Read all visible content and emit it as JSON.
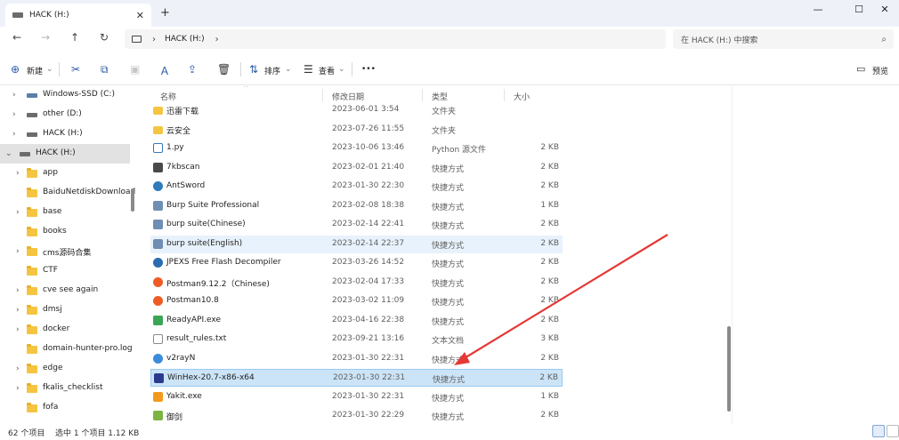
{
  "window": {
    "tab_title": "HACK (H:)",
    "tab_close": "✕",
    "new_tab": "+",
    "minimize": "—",
    "maximize": "☐",
    "close": "✕"
  },
  "nav": {
    "back": "←",
    "forward": "→",
    "up": "↑",
    "refresh": "↻",
    "chevron": "›",
    "path": "HACK (H:)",
    "path_chevron": "›",
    "search_placeholder": "在 HACK (H:) 中搜索",
    "search_icon": "⌕"
  },
  "toolbar": {
    "new_label": "新建",
    "new_dropdown": "⌄",
    "cut_icon": "✂",
    "copy_icon": "⧉",
    "paste_icon": "▣",
    "rename_icon": "Ａ",
    "share_icon": "⇪",
    "delete_icon": "🗑",
    "sort_label": "排序",
    "sort_dropdown": "⌄",
    "view_label": "查看",
    "view_dropdown": "⌄",
    "more_icon": "•••",
    "preview_label": "预览"
  },
  "sidebar": {
    "items": [
      {
        "label": "Windows-SSD (C:)",
        "level": 1,
        "expander": "›",
        "icon": "windows-drive-icon"
      },
      {
        "label": "other (D:)",
        "level": 1,
        "expander": "›",
        "icon": "drive-icon"
      },
      {
        "label": "HACK (H:)",
        "level": 1,
        "expander": "›",
        "icon": "drive-icon"
      },
      {
        "label": "HACK (H:)",
        "level": 0,
        "expander": "⌄",
        "icon": "drive-icon",
        "selected": true
      },
      {
        "label": "app",
        "level": 2,
        "expander": "›",
        "icon": "folder-icon"
      },
      {
        "label": "BaiduNetdiskDownload",
        "level": 2,
        "expander": "",
        "icon": "folder-icon"
      },
      {
        "label": "base",
        "level": 2,
        "expander": "›",
        "icon": "folder-icon"
      },
      {
        "label": "books",
        "level": 2,
        "expander": "",
        "icon": "folder-icon"
      },
      {
        "label": "cms源码合集",
        "level": 2,
        "expander": "›",
        "icon": "folder-icon"
      },
      {
        "label": "CTF",
        "level": 2,
        "expander": "",
        "icon": "folder-icon"
      },
      {
        "label": "cve see again",
        "level": 2,
        "expander": "›",
        "icon": "folder-icon"
      },
      {
        "label": "dmsj",
        "level": 2,
        "expander": "›",
        "icon": "folder-icon"
      },
      {
        "label": "docker",
        "level": 2,
        "expander": "›",
        "icon": "folder-icon"
      },
      {
        "label": "domain-hunter-pro.log",
        "level": 2,
        "expander": "",
        "icon": "folder-icon"
      },
      {
        "label": "edge",
        "level": 2,
        "expander": "›",
        "icon": "folder-icon"
      },
      {
        "label": "fkalis_checklist",
        "level": 2,
        "expander": "›",
        "icon": "folder-icon"
      },
      {
        "label": "fofa",
        "level": 2,
        "expander": "",
        "icon": "folder-icon"
      }
    ]
  },
  "columns": {
    "name": "名称",
    "date": "修改日期",
    "type": "类型",
    "size": "大小",
    "sort_arrow": "^"
  },
  "files": [
    {
      "name": "迅雷下载",
      "date": "2023-06-01 3:54",
      "type": "文件夹",
      "size": "",
      "icon": "folder-icon",
      "color": "#f5c542"
    },
    {
      "name": "云安全",
      "date": "2023-07-26 11:55",
      "type": "文件夹",
      "size": "",
      "icon": "folder-icon",
      "color": "#f5c542"
    },
    {
      "name": "1.py",
      "date": "2023-10-06 13:46",
      "type": "Python 源文件",
      "size": "2 KB",
      "icon": "python-file-icon",
      "color": "#3b77b8"
    },
    {
      "name": "7kbscan",
      "date": "2023-02-01 21:40",
      "type": "快捷方式",
      "size": "2 KB",
      "icon": "app-shortcut-icon",
      "color": "#4a4a4a"
    },
    {
      "name": "AntSword",
      "date": "2023-01-30 22:30",
      "type": "快捷方式",
      "size": "2 KB",
      "icon": "antsword-icon",
      "color": "#2e7bbd"
    },
    {
      "name": "Burp Suite Professional",
      "date": "2023-02-08 18:38",
      "type": "快捷方式",
      "size": "1 KB",
      "icon": "burp-icon",
      "color": "#6f8eb3"
    },
    {
      "name": "burp suite(Chinese)",
      "date": "2023-02-14 22:41",
      "type": "快捷方式",
      "size": "2 KB",
      "icon": "burp-icon",
      "color": "#6f8eb3"
    },
    {
      "name": "burp suite(English)",
      "date": "2023-02-14 22:37",
      "type": "快捷方式",
      "size": "2 KB",
      "icon": "burp-icon",
      "color": "#6f8eb3",
      "hover": true
    },
    {
      "name": "JPEXS Free Flash Decompiler",
      "date": "2023-03-26 14:52",
      "type": "快捷方式",
      "size": "2 KB",
      "icon": "jpexs-icon",
      "color": "#2b6cb0"
    },
    {
      "name": "Postman9.12.2（Chinese)",
      "date": "2023-02-04 17:33",
      "type": "快捷方式",
      "size": "2 KB",
      "icon": "postman-icon",
      "color": "#ef5b25"
    },
    {
      "name": "Postman10.8",
      "date": "2023-03-02 11:09",
      "type": "快捷方式",
      "size": "2 KB",
      "icon": "postman-icon",
      "color": "#ef5b25"
    },
    {
      "name": "ReadyAPI.exe",
      "date": "2023-04-16 22:38",
      "type": "快捷方式",
      "size": "2 KB",
      "icon": "readyapi-icon",
      "color": "#3aa655"
    },
    {
      "name": "result_rules.txt",
      "date": "2023-09-21 13:16",
      "type": "文本文档",
      "size": "3 KB",
      "icon": "text-file-icon",
      "color": "#ffffff"
    },
    {
      "name": "v2rayN",
      "date": "2023-01-30 22:31",
      "type": "快捷方式",
      "size": "2 KB",
      "icon": "v2ray-icon",
      "color": "#3c8dd9"
    },
    {
      "name": "WinHex-20.7-x86-x64",
      "date": "2023-01-30 22:31",
      "type": "快捷方式",
      "size": "2 KB",
      "icon": "winhex-icon",
      "color": "#2b3a8c",
      "selected": true
    },
    {
      "name": "Yakit.exe",
      "date": "2023-01-30 22:31",
      "type": "快捷方式",
      "size": "1 KB",
      "icon": "yakit-icon",
      "color": "#f39a1e"
    },
    {
      "name": "御剑",
      "date": "2023-01-30 22:29",
      "type": "快捷方式",
      "size": "2 KB",
      "icon": "yujian-icon",
      "color": "#7db343"
    }
  ],
  "status": {
    "item_count": "62 个项目",
    "selection": "选中 1 个项目  1.12 KB"
  },
  "colors": {
    "accent": "#2a5aa8",
    "selection_bg": "#cce4f7",
    "arrow": "#e53935"
  }
}
